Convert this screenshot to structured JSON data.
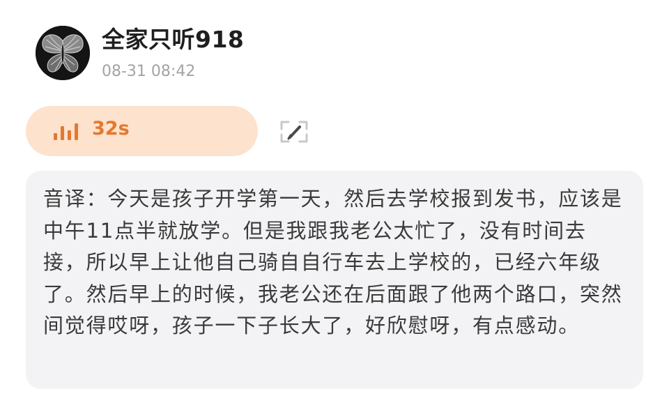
{
  "post": {
    "username": "全家只听918",
    "timestamp": "08-31 08:42"
  },
  "voice_message": {
    "duration": "32s",
    "icon": "audio-bars-icon",
    "accent_color": "#e4782f",
    "background_color": "#fde2cd"
  },
  "edit_action": {
    "icon": "edit-pencil-icon"
  },
  "transcript": {
    "text": "音译：今天是孩子开学第一天，然后去学校报到发书，应该是中午11点半就放学。但是我跟我老公太忙了，没有时间去接，所以早上让他自己骑自自行车去上学校的，已经六年级了。然后早上的时候，我老公还在后面跟了他两个路口，突然间觉得哎呀，孩子一下子长大了，好欣慰呀，有点感动。"
  }
}
